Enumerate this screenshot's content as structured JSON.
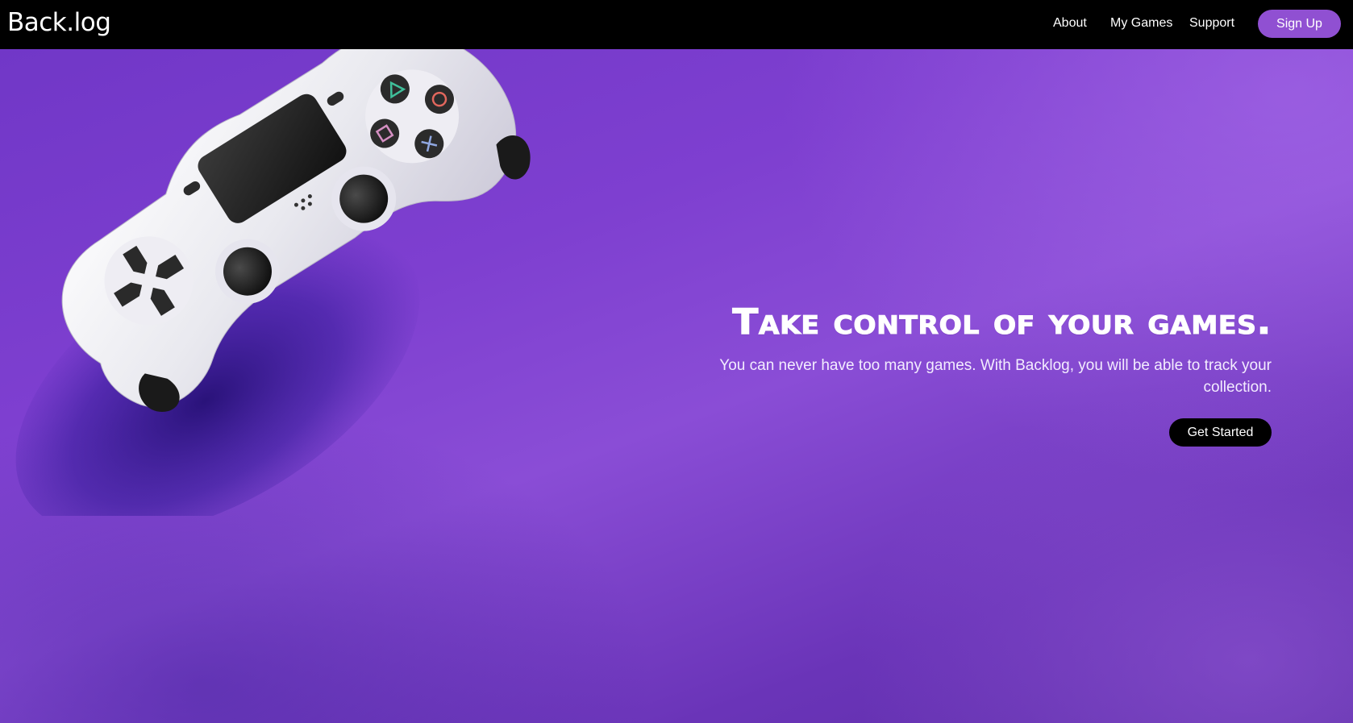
{
  "nav": {
    "brand": "Back.log",
    "links": [
      {
        "label": "About"
      },
      {
        "label": "My Games"
      },
      {
        "label": "Support"
      }
    ],
    "signup_label": "Sign Up"
  },
  "hero": {
    "title": "Take control of your games.",
    "subtitle": "You can never have too many games. With Backlog, you will be able to track your collection.",
    "cta_label": "Get Started",
    "image": "game-controller-photo"
  },
  "colors": {
    "navbar_bg": "#000000",
    "accent": "#9050d2",
    "hero_bg": "#7e3fd0",
    "cta_bg": "#000000",
    "text": "#ffffff"
  }
}
